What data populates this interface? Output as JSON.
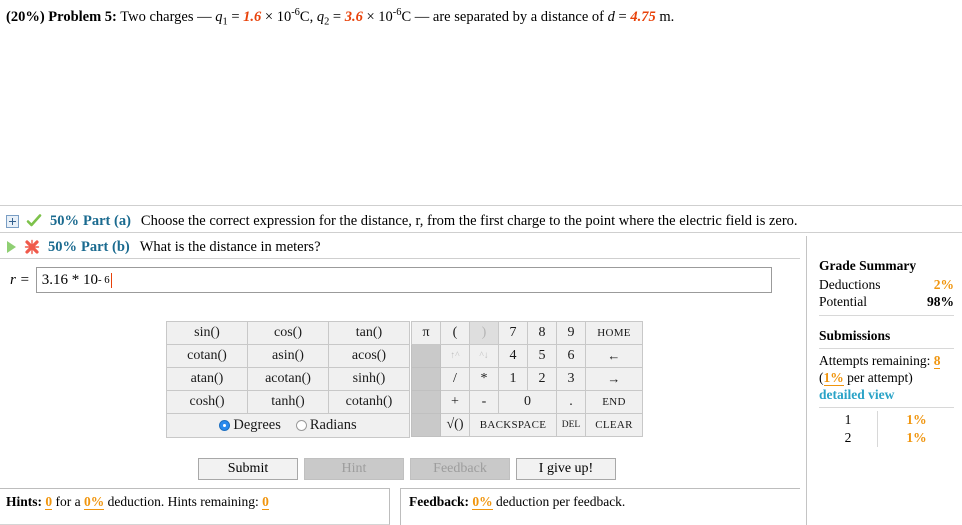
{
  "problem": {
    "weight": "(20%)",
    "label": "Problem 5:",
    "intro": "Two charges —",
    "q1_name": "q",
    "q1_sub": "1",
    "q1_eq": " = ",
    "q1_value": "1.6",
    "q1_times": " × 10",
    "q1_exp": "-6",
    "q1_unit": "C,",
    "q2_name": "q",
    "q2_sub": "2",
    "q2_eq": " = ",
    "q2_value": "3.6",
    "q2_times": " × 10",
    "q2_exp": "-6",
    "q2_unit": "C",
    "middle": "— are separated by a distance of ",
    "d_name": "d",
    "d_eq": " = ",
    "d_value": "4.75",
    "d_unit": " m."
  },
  "parts": [
    {
      "toggle_icon": "plus-box-icon",
      "status_icon": "green-check-icon",
      "weight": "50%",
      "label": "Part (a)",
      "text": "Choose the correct expression for the distance, r, from the first charge to the point where the electric field is zero."
    },
    {
      "toggle_icon": "green-triangle-icon",
      "status_icon": "red-cross-icon",
      "weight": "50%",
      "label": "Part (b)",
      "text": "What is the distance in meters?"
    }
  ],
  "answer": {
    "variable": "r =",
    "mantissa": "3.16 * 10",
    "exponent": "- 6"
  },
  "calculator": {
    "function_rows": [
      [
        "sin()",
        "cos()",
        "tan()"
      ],
      [
        "cotan()",
        "asin()",
        "acos()"
      ],
      [
        "atan()",
        "acotan()",
        "sinh()"
      ],
      [
        "cosh()",
        "tanh()",
        "cotanh()"
      ]
    ],
    "mode": {
      "degrees_label": "Degrees",
      "radians_label": "Radians",
      "selected": "Degrees"
    },
    "keypad_rows": [
      [
        "π",
        "(",
        ")",
        "7",
        "8",
        "9",
        "HOME"
      ],
      [
        "",
        "↑^",
        "^↓",
        "4",
        "5",
        "6",
        "←"
      ],
      [
        "",
        "/",
        "*",
        "1",
        "2",
        "3",
        "→"
      ],
      [
        "",
        "+",
        "-",
        "0",
        ".",
        "END"
      ],
      [
        "",
        "√()",
        "BACKSPACE",
        "DEL",
        "CLEAR"
      ]
    ]
  },
  "actions": [
    {
      "label": "Submit",
      "enabled": true
    },
    {
      "label": "Hint",
      "enabled": false
    },
    {
      "label": "Feedback",
      "enabled": false
    },
    {
      "label": "I give up!",
      "enabled": true
    }
  ],
  "hints": {
    "label": "Hints:",
    "count": "0",
    "mid1": " for a ",
    "deduction": "0%",
    "mid2": " deduction. Hints remaining: ",
    "remaining": "0"
  },
  "feedback": {
    "label": "Feedback:",
    "deduction": "0%",
    "text": " deduction per feedback."
  },
  "grade_summary": {
    "title": "Grade Summary",
    "deductions_label": "Deductions",
    "deductions_value": "2%",
    "potential_label": "Potential",
    "potential_value": "98%",
    "submissions_title": "Submissions",
    "attempts_label": "Attempts remaining: ",
    "attempts_value": "8",
    "per_attempt_open": "(",
    "per_attempt_value": "1%",
    "per_attempt_close": " per attempt)",
    "detailed_view": "detailed view",
    "rows": [
      {
        "n": "1",
        "pct": "1%"
      },
      {
        "n": "2",
        "pct": "1%"
      }
    ]
  },
  "colors": {
    "value_orange": "#e8420a",
    "part_blue": "#1a6a8f",
    "link_orange": "#f0950e",
    "detailed_cyan": "#2aa3c7"
  }
}
